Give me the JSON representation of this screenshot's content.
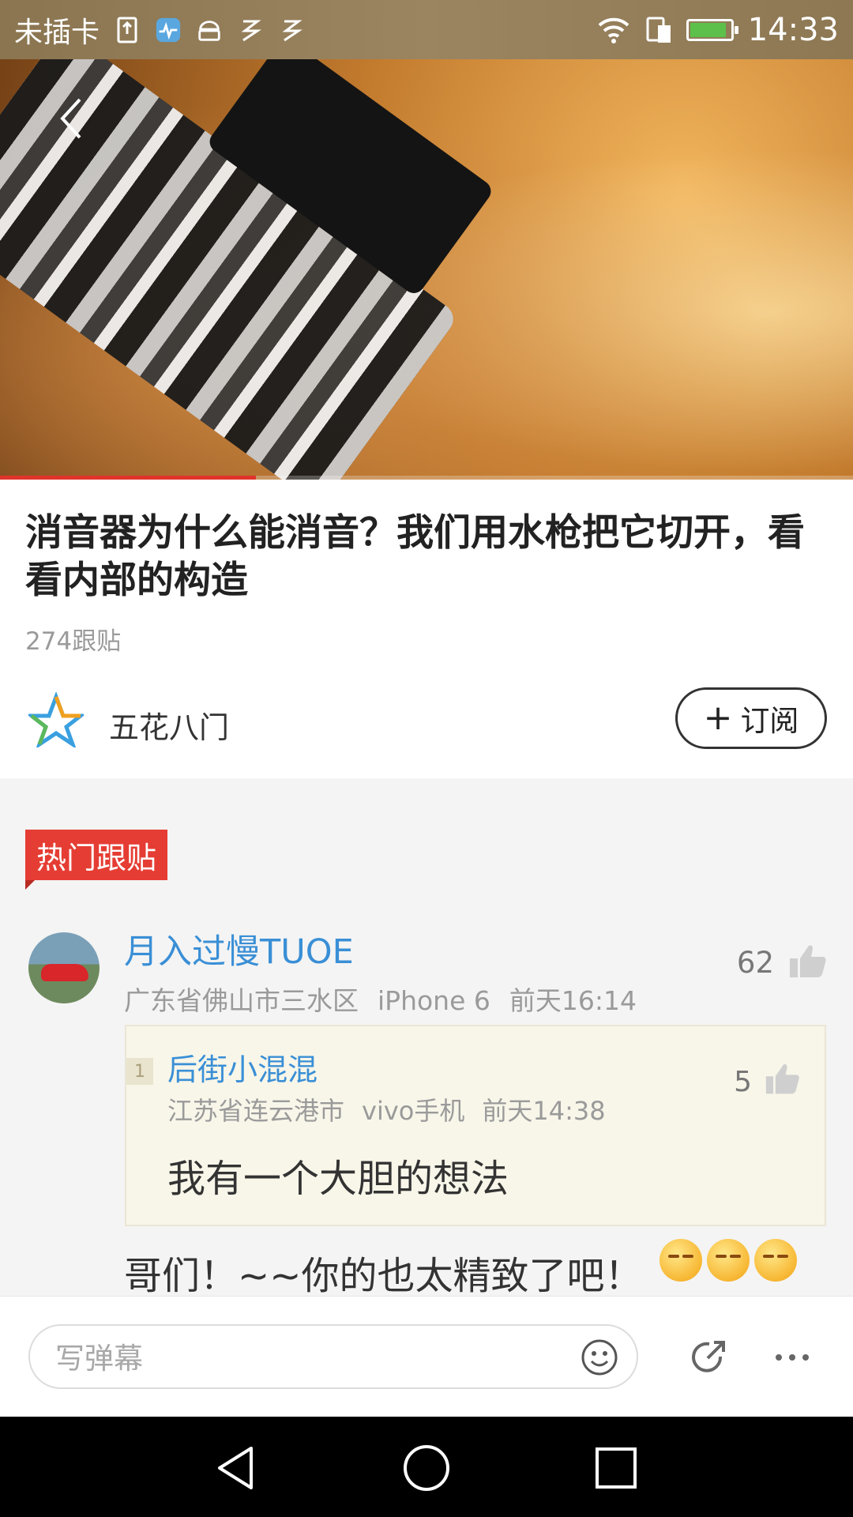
{
  "status_bar": {
    "carrier": "未插卡",
    "time": "14:33",
    "icons": [
      "sim-icon",
      "health-icon",
      "android-icon",
      "app-icon",
      "app-icon",
      "wifi-icon",
      "sim-data-icon",
      "battery-icon"
    ],
    "battery_color": "#5cc04a",
    "battery_level": 0.92
  },
  "video": {
    "progress": 0.3
  },
  "article": {
    "title": "消音器为什么能消音？我们用水枪把它切开，看看内部的构造",
    "follow_count": "274跟贴"
  },
  "source": {
    "name": "五花八门",
    "subscribe_label": "订阅"
  },
  "comments": {
    "section_label": "热门跟贴",
    "accent": "#e53d33",
    "items": [
      {
        "user": "月入过慢TUOE",
        "location": "广东省佛山市三水区",
        "device": "iPhone 6",
        "time": "前天16:14",
        "likes": "62",
        "quote": {
          "index": "1",
          "user": "后街小混混",
          "location": "江苏省连云港市",
          "device": "vivo手机",
          "time": "前天14:38",
          "likes": "5",
          "body": "我有一个大胆的想法"
        },
        "body": "哥们！~~你的也太精致了吧！"
      }
    ]
  },
  "input_bar": {
    "placeholder": "写弹幕"
  }
}
